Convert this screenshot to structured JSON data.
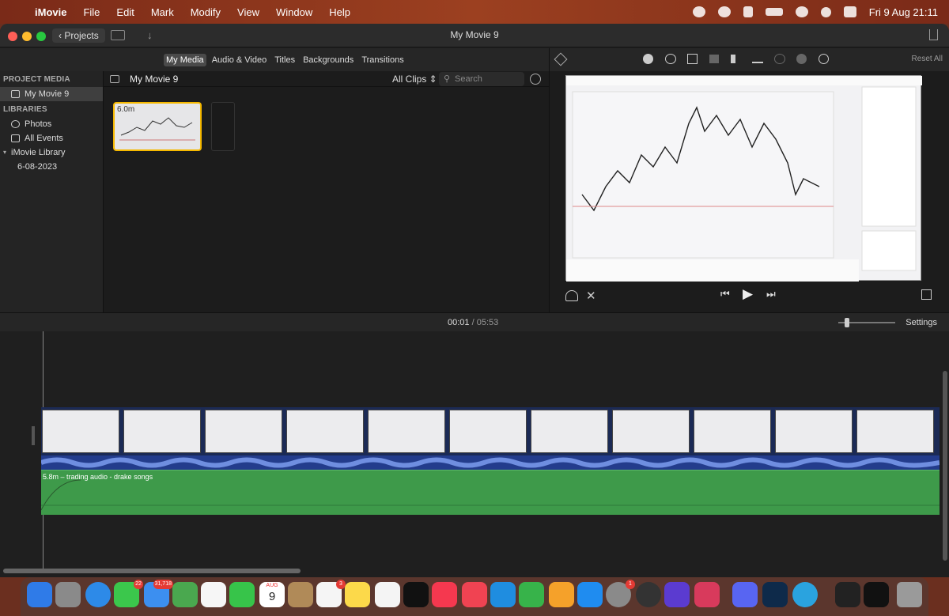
{
  "menubar": {
    "app_name": "iMovie",
    "items": [
      "File",
      "Edit",
      "Mark",
      "Modify",
      "View",
      "Window",
      "Help"
    ],
    "clock": "Fri 9 Aug  21:11"
  },
  "window": {
    "title": "My Movie 9",
    "projects_label": "Projects"
  },
  "media_tabs": [
    "My Media",
    "Audio & Video",
    "Titles",
    "Backgrounds",
    "Transitions"
  ],
  "sidebar": {
    "project_media_header": "PROJECT MEDIA",
    "project_item": "My Movie 9",
    "libraries_header": "LIBRARIES",
    "photos": "Photos",
    "all_events": "All Events",
    "library": "iMovie Library",
    "event": "6-08-2023"
  },
  "browser": {
    "title": "My Movie 9",
    "filter": "All Clips",
    "search_placeholder": "Search",
    "clip_duration": "6.0m"
  },
  "viewer": {
    "reset_all": "Reset All"
  },
  "timeline": {
    "current_time": "00:01",
    "separator": "/",
    "total_time": "05:53",
    "settings": "Settings",
    "audio_clip_label": "5.8m – trading audio - drake songs"
  },
  "dock": {
    "messages_badge": "22",
    "mail_badge": "31,718",
    "reminders_badge": "3",
    "settings_badge": "1",
    "calendar_month": "AUG",
    "calendar_day": "9"
  }
}
